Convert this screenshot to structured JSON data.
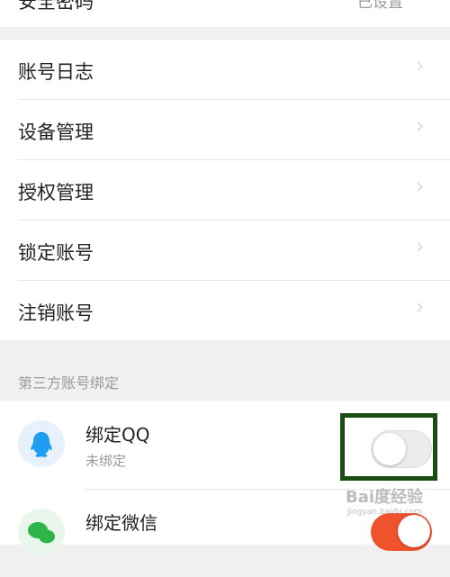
{
  "top_row": {
    "label": "安全密码",
    "value": "已设置"
  },
  "menu": [
    {
      "label": "账号日志"
    },
    {
      "label": "设备管理"
    },
    {
      "label": "授权管理"
    },
    {
      "label": "锁定账号"
    },
    {
      "label": "注销账号"
    }
  ],
  "section_title": "第三方账号绑定",
  "bindings": [
    {
      "title": "绑定QQ",
      "status": "未绑定",
      "enabled": false,
      "icon": "qq-icon",
      "color": "#1e9df2"
    },
    {
      "title": "绑定微信",
      "status": "",
      "enabled": true,
      "icon": "wechat-icon",
      "color": "#2fb44a"
    }
  ],
  "toggle_on_color": "#f0522e",
  "highlight_color": "#184d12",
  "watermark": {
    "text": "Bai度经验",
    "sub": "jingyan.baidu.com"
  }
}
